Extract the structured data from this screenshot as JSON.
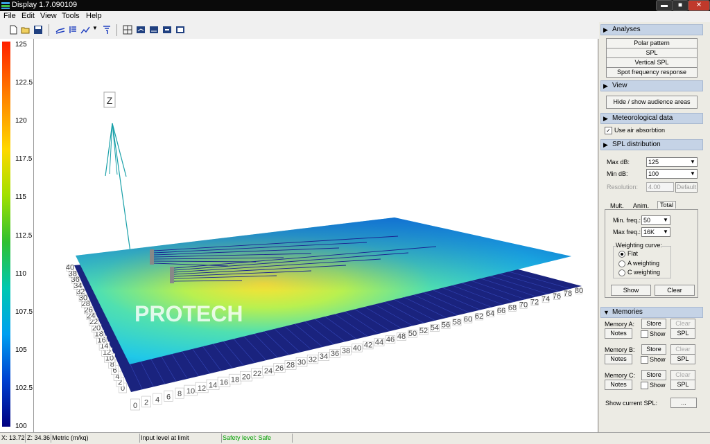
{
  "window": {
    "title": "Display 1.7.090109",
    "min": "▬",
    "max": "■",
    "close": "✕"
  },
  "menu": [
    "File",
    "Edit",
    "View",
    "Tools",
    "Help"
  ],
  "scale": {
    "ticks": [
      "125",
      "122.5",
      "120",
      "117.5",
      "115",
      "112.5",
      "110",
      "107.5",
      "105",
      "102.5",
      "100"
    ]
  },
  "view3d": {
    "axis_label": "Z",
    "watermark": "PROTECH",
    "front_axis": [
      "0",
      "2",
      "4",
      "6",
      "8",
      "10",
      "12",
      "14",
      "16",
      "18",
      "20",
      "22",
      "24",
      "26",
      "28",
      "30",
      "32",
      "34",
      "36",
      "38",
      "40",
      "42",
      "44",
      "46",
      "48",
      "50",
      "52",
      "54",
      "56",
      "58",
      "60",
      "62",
      "64",
      "66",
      "68",
      "70",
      "72",
      "74",
      "76",
      "78",
      "80"
    ],
    "side_axis": [
      "0",
      "2",
      "4",
      "6",
      "8",
      "10",
      "12",
      "14",
      "16",
      "18",
      "20",
      "22",
      "24",
      "26",
      "28",
      "30",
      "32",
      "34",
      "36",
      "38",
      "40"
    ]
  },
  "panel": {
    "analyses": {
      "header": "Analyses",
      "buttons": [
        "Polar pattern",
        "SPL",
        "Vertical SPL",
        "Spot frequency response"
      ]
    },
    "view": {
      "header": "View",
      "hide_show": "Hide / show audience areas"
    },
    "meteo": {
      "header": "Meteorological data",
      "air_label": "Use air absorbtion",
      "air_checked": true
    },
    "spl": {
      "header": "SPL distribution",
      "max_label": "Max dB:",
      "max_value": "125",
      "min_label": "Min dB:",
      "min_value": "100",
      "res_label": "Resolution:",
      "res_value": "4.00",
      "default_btn": "Default",
      "tabs": [
        "Mult.",
        "Anim.",
        "Total"
      ],
      "minfreq_label": "Min. freq.:",
      "minfreq_value": "50",
      "maxfreq_label": "Max freq.:",
      "maxfreq_value": "16K",
      "weighting_title": "Weighting curve:",
      "weightings": [
        "Flat",
        "A weighting",
        "C weighting"
      ],
      "weighting_selected": "Flat",
      "show_btn": "Show",
      "clear_btn": "Clear"
    },
    "memories": {
      "header": "Memories",
      "items": [
        {
          "label": "Memory A:",
          "store": "Store",
          "clear": "Clear",
          "notes": "Notes",
          "show": "Show",
          "spl": "SPL"
        },
        {
          "label": "Memory B:",
          "store": "Store",
          "clear": "Clear",
          "notes": "Notes",
          "show": "Show",
          "spl": "SPL"
        },
        {
          "label": "Memory C:",
          "store": "Store",
          "clear": "Clear",
          "notes": "Notes",
          "show": "Show",
          "spl": "SPL"
        }
      ],
      "current_label": "Show current SPL:",
      "current_btn": "..."
    }
  },
  "status": {
    "x": "X: 13.72",
    "z": "Z: 34.36",
    "units": "Metric (m/kq)",
    "input": "Input level at limit",
    "safety": "Safety level: Safe"
  },
  "colors": {
    "accent_header": "#c5d3e6",
    "safety_text": "#00a000"
  }
}
